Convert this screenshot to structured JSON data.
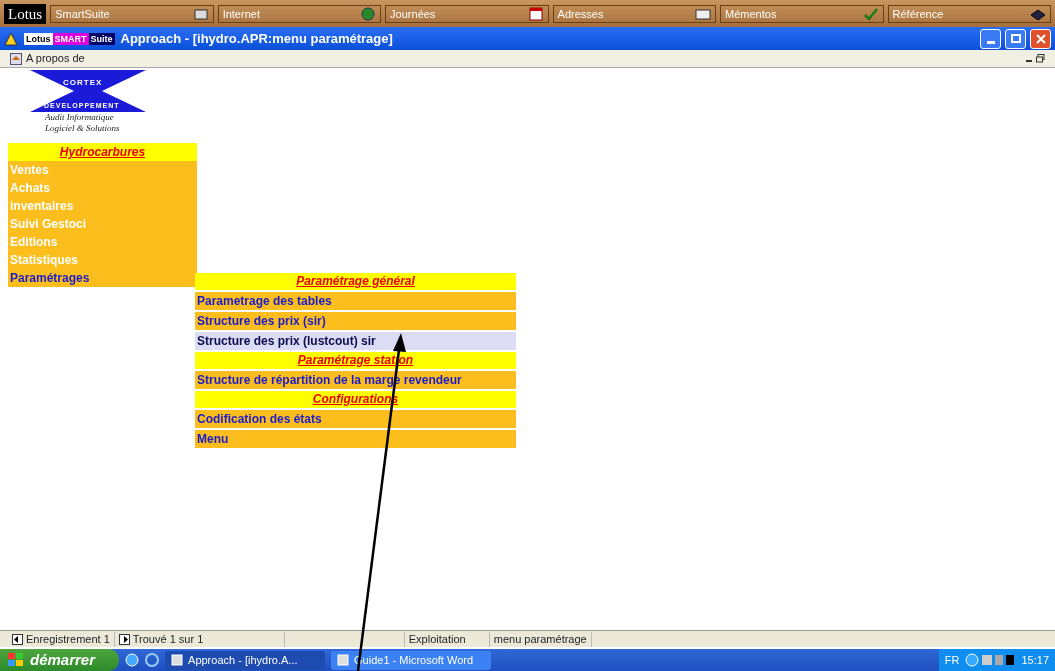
{
  "suite_bar": {
    "brand": "Lotus",
    "items": [
      {
        "label": "SmartSuite"
      },
      {
        "label": "Internet"
      },
      {
        "label": "Journées"
      },
      {
        "label": "Adresses"
      },
      {
        "label": "Mémentos"
      },
      {
        "label": "Référence"
      }
    ]
  },
  "title_bar": {
    "logo_text": [
      "Lotus",
      "SMART",
      "Suite"
    ],
    "title": "Approach - [ihydro.APR:menu paramétrage]"
  },
  "menu_bar": {
    "items": [
      "A propos de"
    ]
  },
  "logo": {
    "top": "CORTEX",
    "bottom": "DEVELOPPEMENT",
    "tagline": [
      "Audit Informatique",
      "Logiciel & Solutions"
    ]
  },
  "main_menu": {
    "header": "Hydrocarbures",
    "items": [
      {
        "label": "Ventes",
        "selected": false
      },
      {
        "label": "Achats",
        "selected": false
      },
      {
        "label": "inventaires",
        "selected": false
      },
      {
        "label": "Suivi Gestoci",
        "selected": false
      },
      {
        "label": "Editions",
        "selected": false
      },
      {
        "label": "Statistiques",
        "selected": false
      },
      {
        "label": "Paramétrages",
        "selected": true
      }
    ]
  },
  "submenu": {
    "sections": [
      {
        "header": "Paramétrage général",
        "items": [
          {
            "label": "Parametrage des tables",
            "selected": false
          },
          {
            "label": "Structure des prix (sir)",
            "selected": false
          },
          {
            "label": "Structure des prix (lustcout) sir",
            "selected": true
          }
        ]
      },
      {
        "header": "Paramétrage station",
        "items": [
          {
            "label": "Structure de répartition de la marge revendeur",
            "selected": false
          }
        ]
      },
      {
        "header": "Configurations",
        "items": [
          {
            "label": "Codification des états",
            "selected": false
          },
          {
            "label": "Menu",
            "selected": false
          }
        ]
      }
    ]
  },
  "status_bar": {
    "record": "Enregistrement 1",
    "found": "Trouvé 1 sur 1",
    "mode": "Exploitation",
    "layout": "menu paramétrage"
  },
  "taskbar": {
    "start": "démarrer",
    "tasks": [
      {
        "label": "Approach - [ihydro.A...",
        "selected": true
      },
      {
        "label": "Guide1 - Microsoft Word",
        "selected": false
      }
    ],
    "language": "FR",
    "clock": "15:17"
  }
}
